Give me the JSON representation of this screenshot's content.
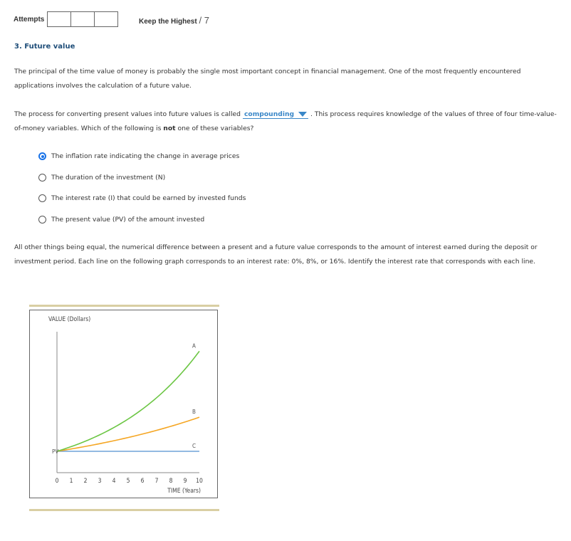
{
  "header": {
    "attempts_label": "Attempts",
    "attempt_boxes": 3,
    "keep_label": "Keep the Highest",
    "points": "/ 7"
  },
  "question": {
    "title": "3. Future value",
    "intro": "The principal of the time value of money is probably the single most important concept in financial management. One of the most frequently encountered applications involves the calculation of a future value.",
    "process_before": "The process for converting present values into future values is called ",
    "dropdown_value": "compounding",
    "process_after": " . This process requires knowledge of the values of three of four time-value-of-money variables. Which of the following is ",
    "process_bold": "not",
    "process_end": " one of these variables?",
    "options": [
      {
        "label": "The inflation rate indicating the change in average prices",
        "selected": true
      },
      {
        "label": "The duration of the investment (N)",
        "selected": false
      },
      {
        "label": "The interest rate (I) that could be earned by invested funds",
        "selected": false
      },
      {
        "label": "The present value (PV) of the amount invested",
        "selected": false
      }
    ],
    "graph_intro": "All other things being equal, the numerical difference between a present and a future value corresponds to the amount of interest earned during the deposit or investment period. Each line on the following graph corresponds to an interest rate: 0%, 8%, or 16%. Identify the interest rate that corresponds with each line."
  },
  "colors": {
    "accent": "#3a87c8",
    "title": "#1f4e79",
    "line_A": "#6cc644",
    "line_B": "#f5a623",
    "line_C": "#6fa3d8",
    "rule": "#d9cfa3"
  },
  "chart_data": {
    "type": "line",
    "title": "",
    "xlabel": "TIME (Years)",
    "ylabel": "VALUE (Dollars)",
    "x": [
      0,
      1,
      2,
      3,
      4,
      5,
      6,
      7,
      8,
      9,
      10
    ],
    "xlim": [
      0,
      10
    ],
    "ylim": [
      0,
      4.8
    ],
    "x_tick_labels": [
      "0",
      "1",
      "2",
      "3",
      "4",
      "5",
      "6",
      "7",
      "8",
      "9",
      "10"
    ],
    "origin_label": "PV",
    "grid": false,
    "series": [
      {
        "name": "A",
        "values": [
          1,
          1.16,
          1.35,
          1.56,
          1.81,
          2.1,
          2.44,
          2.83,
          3.28,
          3.8,
          4.41
        ]
      },
      {
        "name": "B",
        "values": [
          1,
          1.08,
          1.17,
          1.26,
          1.36,
          1.47,
          1.59,
          1.71,
          1.85,
          2.0,
          2.16
        ]
      },
      {
        "name": "C",
        "values": [
          1,
          1,
          1,
          1,
          1,
          1,
          1,
          1,
          1,
          1,
          1
        ]
      }
    ]
  }
}
